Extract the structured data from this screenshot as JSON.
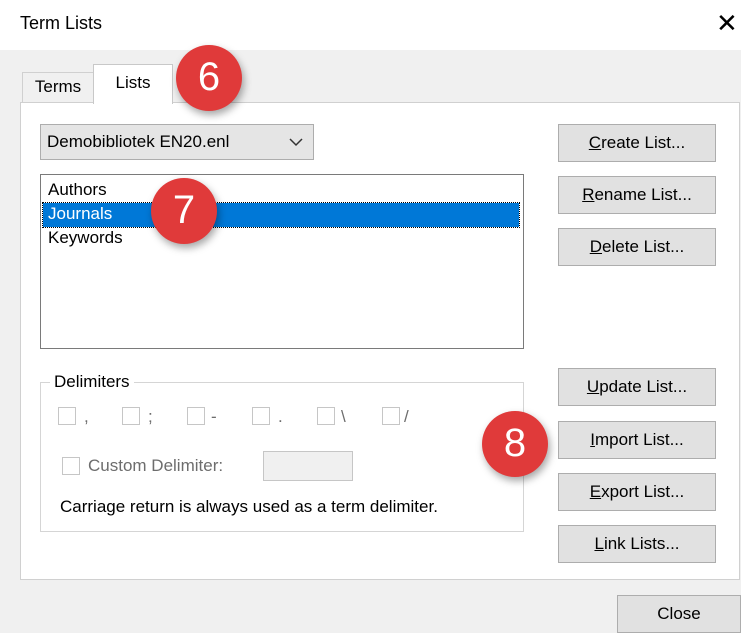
{
  "window": {
    "title": "Term Lists",
    "close_glyph": "✕"
  },
  "tabs": [
    {
      "label": "Terms"
    },
    {
      "label": "Lists"
    }
  ],
  "library_select": {
    "value": "Demobibliotek EN20.enl"
  },
  "lists": [
    {
      "label": "Authors",
      "selected": false
    },
    {
      "label": "Journals",
      "selected": true
    },
    {
      "label": "Keywords",
      "selected": false
    }
  ],
  "buttons": {
    "create": {
      "accel": "C",
      "rest": "reate List..."
    },
    "rename": {
      "accel": "R",
      "rest": "ename List..."
    },
    "delete": {
      "accel": "D",
      "rest": "elete List..."
    },
    "update": {
      "accel": "U",
      "rest": "pdate List..."
    },
    "import": {
      "accel": "I",
      "rest": "mport List..."
    },
    "export": {
      "accel": "E",
      "rest": "xport List..."
    },
    "link": {
      "accel": "L",
      "rest": "ink Lists..."
    },
    "close": "Close"
  },
  "delimiters": {
    "legend": "Delimiters",
    "options": [
      ",",
      ";",
      "-",
      ".",
      "\\",
      "/"
    ],
    "custom_label": "Custom Delimiter:",
    "custom_value": "",
    "note": "Carriage return is always used as a term delimiter."
  },
  "badges": [
    "6",
    "7",
    "8"
  ],
  "colors": {
    "selection": "#0078d7",
    "badge": "#e03a3a"
  }
}
